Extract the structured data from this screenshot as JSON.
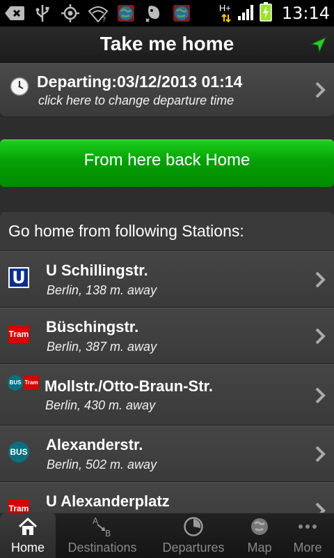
{
  "status_bar": {
    "time": "13:14",
    "network_type": "H+",
    "icons": [
      "back-icon",
      "usb-icon",
      "gps-icon",
      "wifi-icon",
      "globe-icon",
      "evernote-icon",
      "globe-icon",
      "signal-icon",
      "battery-charging-icon"
    ]
  },
  "header": {
    "title": "Take me home"
  },
  "departure": {
    "title": "Departing:03/12/2013 01:14",
    "hint": "click here to change departure time"
  },
  "home_button": {
    "label": "From here back Home"
  },
  "stations": {
    "header": "Go home from following Stations:",
    "items": [
      {
        "name": "U Schillingstr.",
        "distance": "Berlin, 138 m. away",
        "badges": [
          "U"
        ]
      },
      {
        "name": "Büschingstr.",
        "distance": "Berlin, 387 m. away",
        "badges": [
          "Tram"
        ]
      },
      {
        "name": "Mollstr./Otto-Braun-Str.",
        "distance": "Berlin, 430 m. away",
        "badges": [
          "BUS",
          "Tram"
        ]
      },
      {
        "name": "Alexanderstr.",
        "distance": "Berlin, 502 m. away",
        "badges": [
          "BUS"
        ]
      },
      {
        "name": "U Alexanderplatz",
        "distance": "",
        "badges": [
          "Tram"
        ]
      }
    ]
  },
  "tabs": [
    {
      "label": "Home",
      "icon": "home-icon",
      "active": true
    },
    {
      "label": "Destinations",
      "icon": "a-to-b-icon",
      "active": false
    },
    {
      "label": "Departures",
      "icon": "clock-pie-icon",
      "active": false
    },
    {
      "label": "Map",
      "icon": "globe-icon",
      "active": false
    },
    {
      "label": "More",
      "icon": "more-dots-icon",
      "active": false
    }
  ],
  "colors": {
    "accent_green": "#0aa80a",
    "u_blue": "#0a2f8e",
    "tram_red": "#d80000",
    "bus_teal": "#08707f"
  }
}
